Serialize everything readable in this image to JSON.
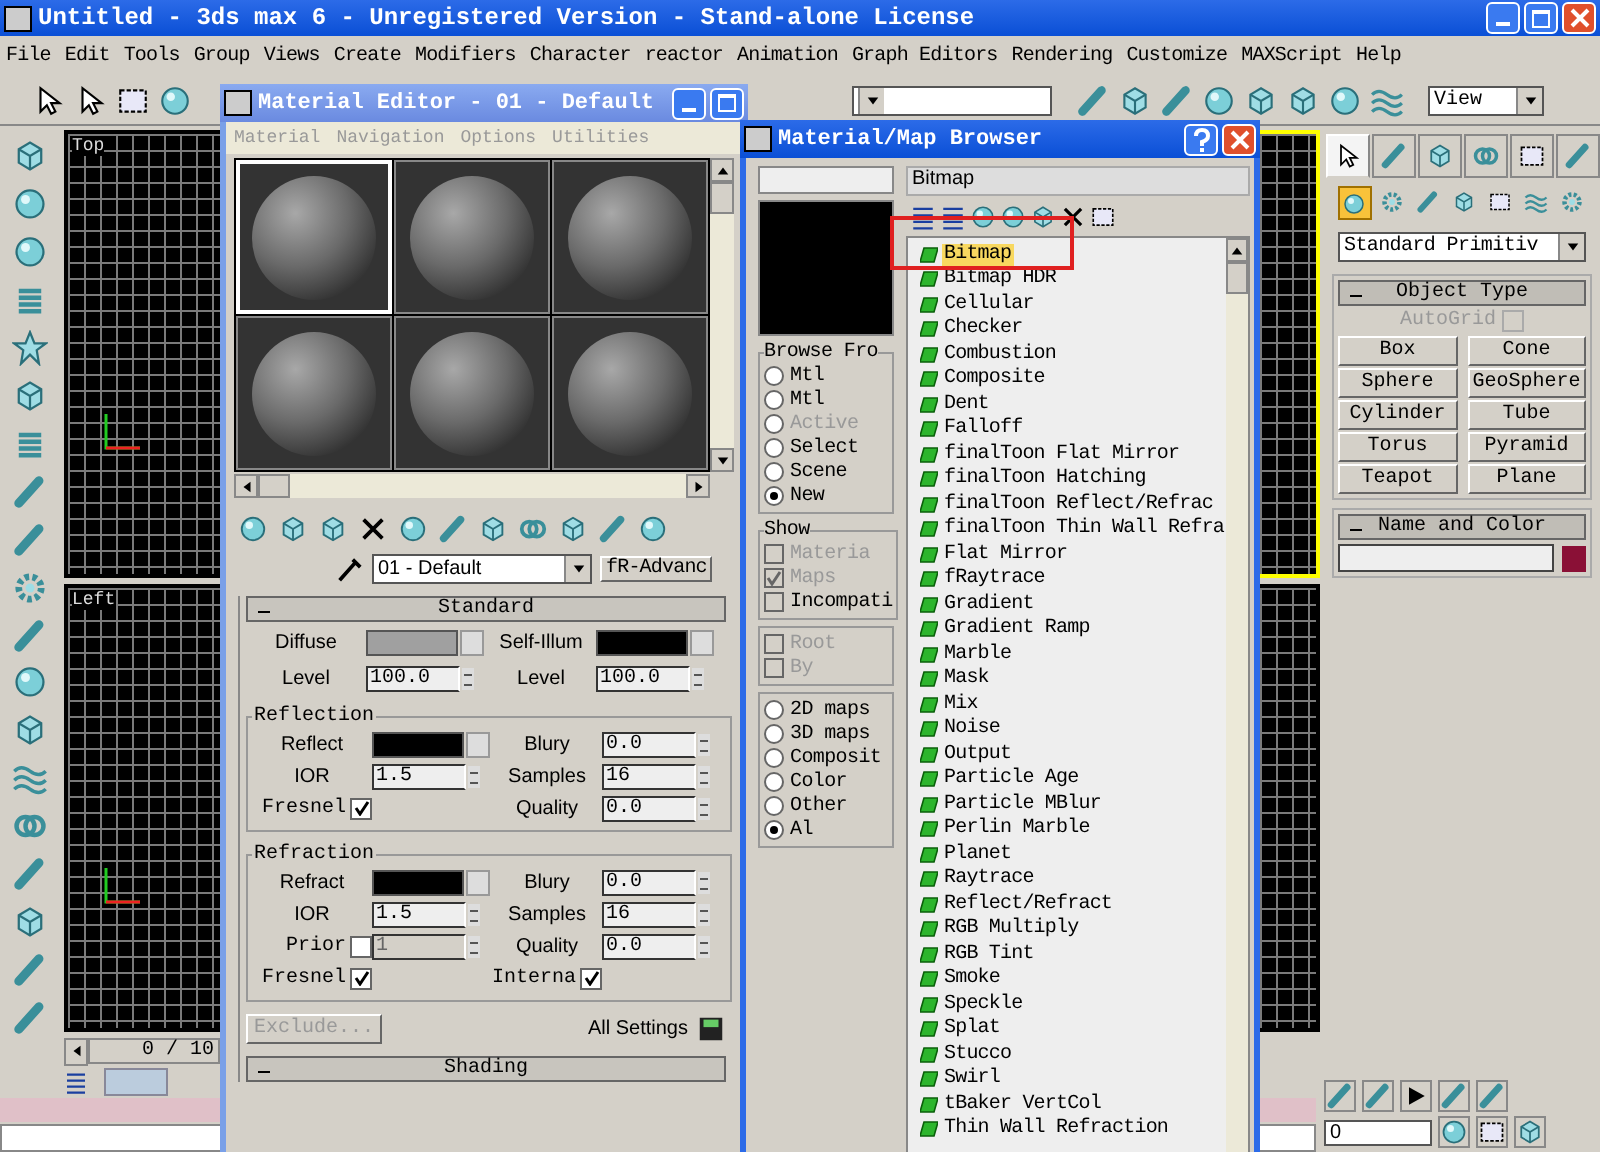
{
  "window": {
    "title": "Untitled - 3ds max 6 - Unregistered Version - Stand-alone License"
  },
  "menu": [
    "File",
    "Edit",
    "Tools",
    "Group",
    "Views",
    "Create",
    "Modifiers",
    "Character",
    "reactor",
    "Animation",
    "Graph Editors",
    "Rendering",
    "Customize",
    "MAXScript",
    "Help"
  ],
  "toolbar": {
    "view_dropdown": "View"
  },
  "viewports": [
    {
      "label": "Top",
      "active": false
    },
    {
      "active": true
    },
    {
      "label": "Left",
      "active": false
    },
    {
      "active": false
    }
  ],
  "time_slider": {
    "label": "0 / 10"
  },
  "command_panel": {
    "tabs": [
      {
        "selected": true
      },
      {
        "selected": false
      },
      {
        "selected": false
      },
      {
        "selected": false
      },
      {
        "selected": false
      },
      {
        "selected": false
      }
    ],
    "categories": [
      {
        "selected": true
      },
      {
        "selected": false
      },
      {
        "selected": false
      },
      {
        "selected": false
      },
      {
        "selected": false
      },
      {
        "selected": false
      },
      {
        "selected": false
      }
    ],
    "dropdown": "Standard Primitiv",
    "object_type": {
      "title": "Object Type",
      "autogrid": {
        "label": "AutoGrid",
        "checked": false,
        "disabled": true
      },
      "buttons": [
        "Box",
        "Cone",
        "Sphere",
        "GeoSphere",
        "Cylinder",
        "Tube",
        "Torus",
        "Pyramid",
        "Teapot",
        "Plane"
      ]
    },
    "name_and_color": {
      "title": "Name and Color"
    }
  },
  "playback": {
    "frame": "0"
  },
  "material_editor": {
    "title": "Material Editor - 01 - Default",
    "menu": [
      "Material",
      "Navigation",
      "Options",
      "Utilities"
    ],
    "slots": [
      {
        "selected": true
      },
      {
        "selected": false
      },
      {
        "selected": false
      },
      {
        "selected": false
      },
      {
        "selected": false
      },
      {
        "selected": false
      }
    ],
    "material_name": "01 - Default",
    "type_button": "fR-Advanc",
    "standard": {
      "title": "Standard",
      "rows": [
        [
          {
            "kind": "color",
            "label": "Diffuse",
            "color": "#a0a0a0"
          },
          {
            "kind": "color",
            "label": "Self-Illum",
            "color": "#000000"
          }
        ],
        [
          {
            "kind": "spinner",
            "label": "Level",
            "value": "100.0"
          },
          {
            "kind": "spinner",
            "label": "Level",
            "value": "100.0"
          }
        ]
      ],
      "groups": [
        {
          "title": "Reflection",
          "rows": [
            [
              {
                "kind": "color",
                "label": "Reflect",
                "color": "#000000"
              },
              {
                "kind": "spinner",
                "label": "Blury",
                "value": "0.0"
              }
            ],
            [
              {
                "kind": "spinner",
                "label": "IOR",
                "value": "1.5"
              },
              {
                "kind": "spinner",
                "label": "Samples",
                "value": "16"
              }
            ],
            [
              {
                "kind": "check",
                "label": "Fresnel",
                "checked": true
              },
              {
                "kind": "spinner",
                "label": "Quality",
                "value": "0.0"
              }
            ]
          ]
        },
        {
          "title": "Refraction",
          "rows": [
            [
              {
                "kind": "color",
                "label": "Refract",
                "color": "#000000"
              },
              {
                "kind": "spinner",
                "label": "Blury",
                "value": "0.0"
              }
            ],
            [
              {
                "kind": "spinner",
                "label": "IOR",
                "value": "1.5"
              },
              {
                "kind": "spinner",
                "label": "Samples",
                "value": "16"
              }
            ],
            [
              {
                "kind": "check_spinner",
                "label": "Prior",
                "checked": false,
                "value": "1",
                "disabled": true
              },
              {
                "kind": "spinner",
                "label": "Quality",
                "value": "0.0"
              }
            ],
            [
              {
                "kind": "check",
                "label": "Fresnel",
                "checked": true
              },
              {
                "kind": "check",
                "label": "Interna",
                "checked": true
              }
            ]
          ]
        }
      ],
      "exclude": {
        "label": "Exclude...",
        "disabled": true
      },
      "all_settings": "All Settings"
    },
    "shading": {
      "title": "Shading"
    }
  },
  "browser": {
    "title": "Material/Map Browser",
    "selected_name": "Bitmap",
    "browse_from": {
      "title": "Browse Fro",
      "options": [
        {
          "label": "Mtl",
          "selected": false,
          "disabled": false
        },
        {
          "label": "Mtl",
          "selected": false,
          "disabled": false
        },
        {
          "label": "Active",
          "selected": false,
          "disabled": true
        },
        {
          "label": "Select",
          "selected": false,
          "disabled": false
        },
        {
          "label": "Scene",
          "selected": false,
          "disabled": false
        },
        {
          "label": "New",
          "selected": true,
          "disabled": false
        }
      ]
    },
    "show": {
      "title": "Show",
      "options": [
        {
          "label": "Materia",
          "checked": false,
          "disabled": true
        },
        {
          "label": "Maps",
          "checked": true,
          "disabled": true
        },
        {
          "label": "Incompati",
          "checked": false,
          "disabled": false
        }
      ]
    },
    "root_options": [
      {
        "label": "Root",
        "checked": false,
        "disabled": true
      },
      {
        "label": "By",
        "checked": false,
        "disabled": true
      }
    ],
    "categories": [
      {
        "label": "2D maps",
        "selected": false
      },
      {
        "label": "3D maps",
        "selected": false
      },
      {
        "label": "Composit",
        "selected": false
      },
      {
        "label": "Color",
        "selected": false
      },
      {
        "label": "Other",
        "selected": false
      },
      {
        "label": "Al",
        "selected": true
      }
    ],
    "items": [
      {
        "label": "Bitmap",
        "selected": true
      },
      {
        "label": "Bitmap HDR",
        "selected": false
      },
      {
        "label": "Cellular",
        "selected": false
      },
      {
        "label": "Checker",
        "selected": false
      },
      {
        "label": "Combustion",
        "selected": false
      },
      {
        "label": "Composite",
        "selected": false
      },
      {
        "label": "Dent",
        "selected": false
      },
      {
        "label": "Falloff",
        "selected": false
      },
      {
        "label": "finalToon Flat Mirror",
        "selected": false
      },
      {
        "label": "finalToon Hatching",
        "selected": false
      },
      {
        "label": "finalToon Reflect/Refrac",
        "selected": false
      },
      {
        "label": "finalToon Thin Wall Refra",
        "selected": false
      },
      {
        "label": "Flat Mirror",
        "selected": false
      },
      {
        "label": "fRaytrace",
        "selected": false
      },
      {
        "label": "Gradient",
        "selected": false
      },
      {
        "label": "Gradient Ramp",
        "selected": false
      },
      {
        "label": "Marble",
        "selected": false
      },
      {
        "label": "Mask",
        "selected": false
      },
      {
        "label": "Mix",
        "selected": false
      },
      {
        "label": "Noise",
        "selected": false
      },
      {
        "label": "Output",
        "selected": false
      },
      {
        "label": "Particle Age",
        "selected": false
      },
      {
        "label": "Particle MBlur",
        "selected": false
      },
      {
        "label": "Perlin Marble",
        "selected": false
      },
      {
        "label": "Planet",
        "selected": false
      },
      {
        "label": "Raytrace",
        "selected": false
      },
      {
        "label": "Reflect/Refract",
        "selected": false
      },
      {
        "label": "RGB Multiply",
        "selected": false
      },
      {
        "label": "RGB Tint",
        "selected": false
      },
      {
        "label": "Smoke",
        "selected": false
      },
      {
        "label": "Speckle",
        "selected": false
      },
      {
        "label": "Splat",
        "selected": false
      },
      {
        "label": "Stucco",
        "selected": false
      },
      {
        "label": "Swirl",
        "selected": false
      },
      {
        "label": "tBaker VertCol",
        "selected": false
      },
      {
        "label": "Thin Wall Refraction",
        "selected": false
      }
    ]
  }
}
